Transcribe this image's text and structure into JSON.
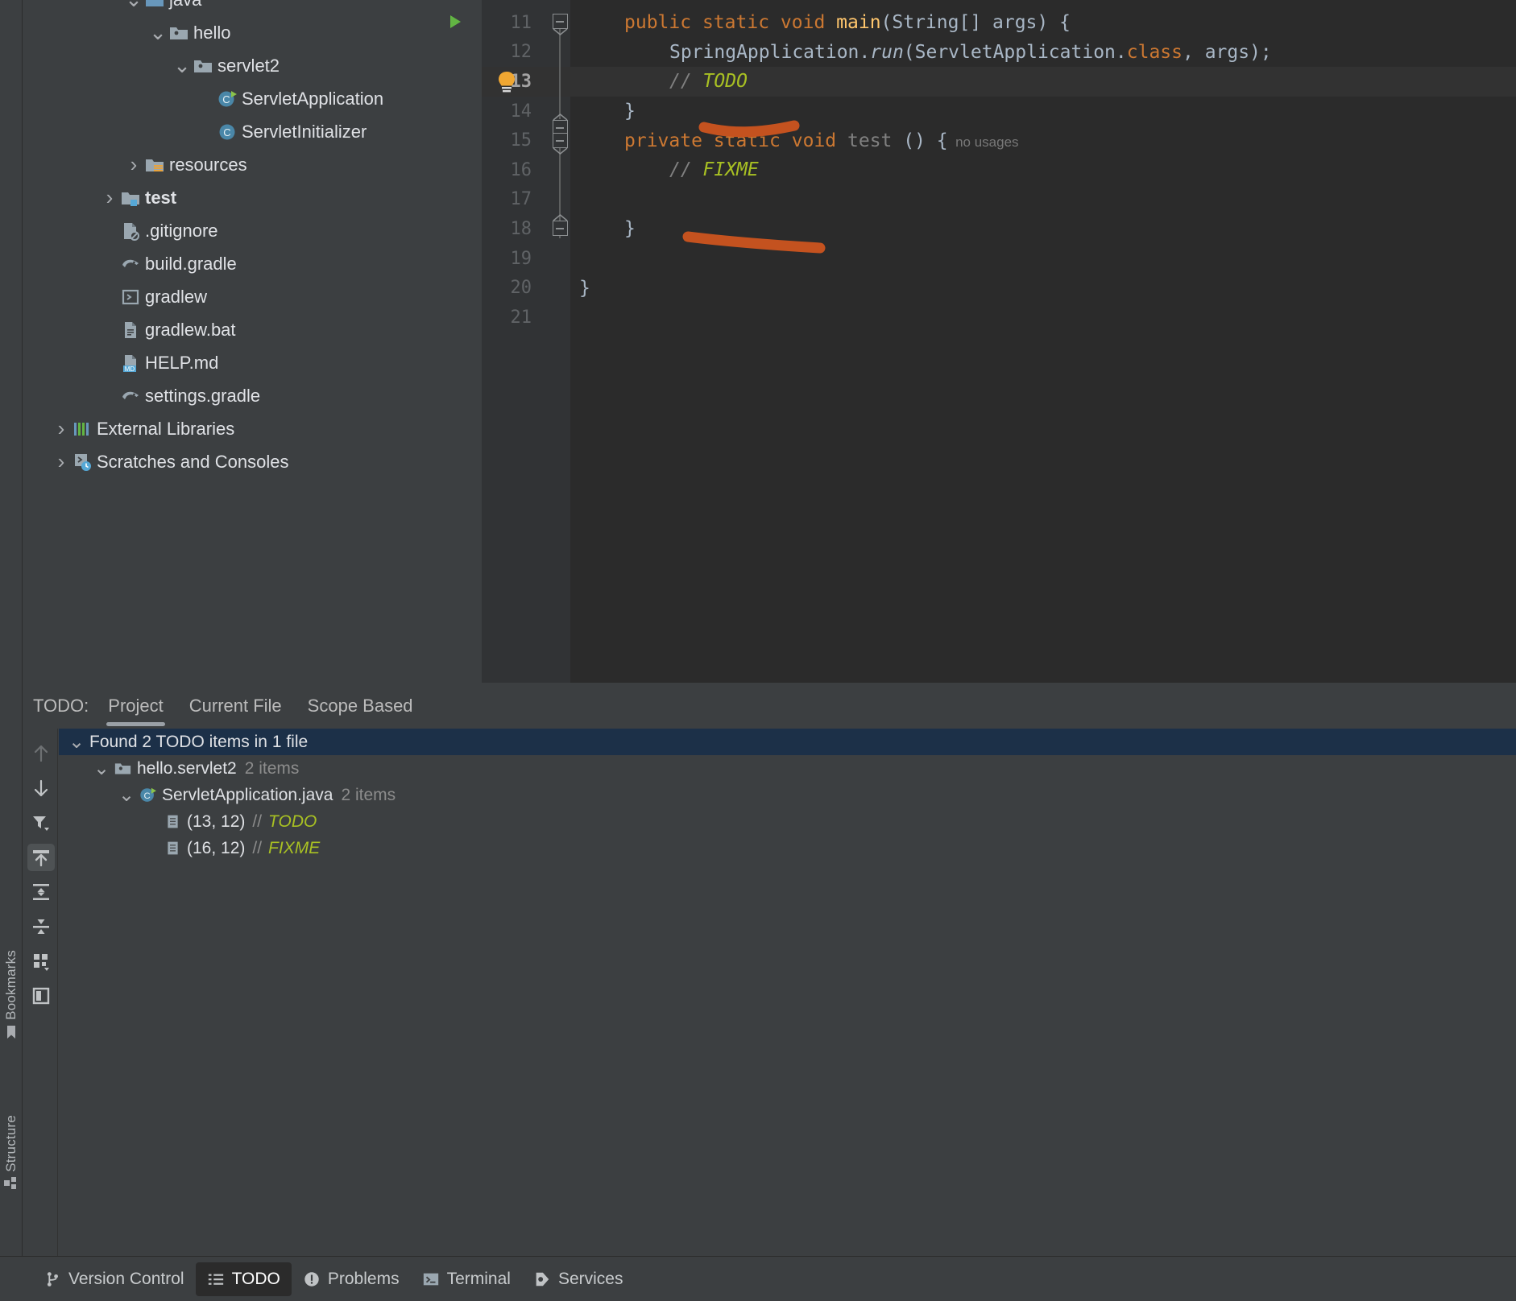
{
  "tool_stripes": {
    "left": [
      {
        "label": "Bookmarks",
        "icon": "bookmark-icon"
      },
      {
        "label": "Structure",
        "icon": "structure-icon"
      }
    ]
  },
  "project_tree": {
    "items": [
      {
        "label": "java",
        "indent": 4,
        "arrow": "down",
        "icon": "source-folder-icon",
        "bold": false,
        "clipped": true
      },
      {
        "label": "hello",
        "indent": 5,
        "arrow": "down",
        "icon": "package-icon",
        "bold": false
      },
      {
        "label": "servlet2",
        "indent": 6,
        "arrow": "down",
        "icon": "package-icon",
        "bold": false
      },
      {
        "label": "ServletApplication",
        "indent": 7,
        "arrow": "none",
        "icon": "java-class-run-icon",
        "bold": false
      },
      {
        "label": "ServletInitializer",
        "indent": 7,
        "arrow": "none",
        "icon": "java-class-icon",
        "bold": false
      },
      {
        "label": "resources",
        "indent": 4,
        "arrow": "right",
        "icon": "resources-folder-icon",
        "bold": false
      },
      {
        "label": "test",
        "indent": 3,
        "arrow": "right",
        "icon": "test-folder-icon",
        "bold": true
      },
      {
        "label": ".gitignore",
        "indent": 3,
        "arrow": "none",
        "icon": "gitignore-icon",
        "bold": false
      },
      {
        "label": "build.gradle",
        "indent": 3,
        "arrow": "none",
        "icon": "gradle-icon",
        "bold": false
      },
      {
        "label": "gradlew",
        "indent": 3,
        "arrow": "none",
        "icon": "shell-script-icon",
        "bold": false
      },
      {
        "label": "gradlew.bat",
        "indent": 3,
        "arrow": "none",
        "icon": "bat-file-icon",
        "bold": false
      },
      {
        "label": "HELP.md",
        "indent": 3,
        "arrow": "none",
        "icon": "markdown-icon",
        "bold": false
      },
      {
        "label": "settings.gradle",
        "indent": 3,
        "arrow": "none",
        "icon": "gradle-icon",
        "bold": false
      },
      {
        "label": "External Libraries",
        "indent": 1,
        "arrow": "right",
        "icon": "libraries-icon",
        "bold": false
      },
      {
        "label": "Scratches and Consoles",
        "indent": 1,
        "arrow": "right",
        "icon": "scratches-icon",
        "bold": false
      }
    ]
  },
  "editor": {
    "first_line_number": 11,
    "current_line": 13,
    "lines": [
      {
        "num": 11,
        "indent": 2,
        "tokens": [
          {
            "t": "public",
            "c": "kw"
          },
          {
            "t": " ",
            "c": "pln"
          },
          {
            "t": "static",
            "c": "kw"
          },
          {
            "t": " ",
            "c": "pln"
          },
          {
            "t": "void",
            "c": "kw"
          },
          {
            "t": " ",
            "c": "pln"
          },
          {
            "t": "main",
            "c": "mth"
          },
          {
            "t": "(String[] args) {",
            "c": "pln"
          }
        ]
      },
      {
        "num": 12,
        "indent": 4,
        "tokens": [
          {
            "t": "SpringApplication.",
            "c": "pln"
          },
          {
            "t": "run",
            "c": "pln ital"
          },
          {
            "t": "(ServletApplication.",
            "c": "pln"
          },
          {
            "t": "class",
            "c": "kw"
          },
          {
            "t": ", args);",
            "c": "pln"
          }
        ]
      },
      {
        "num": 13,
        "indent": 4,
        "tokens": [
          {
            "t": "// ",
            "c": "cmt"
          },
          {
            "t": "TODO",
            "c": "todo"
          }
        ]
      },
      {
        "num": 14,
        "indent": 2,
        "tokens": [
          {
            "t": "}",
            "c": "pln"
          }
        ]
      },
      {
        "num": 15,
        "indent": 2,
        "tokens": [
          {
            "t": "private",
            "c": "kw"
          },
          {
            "t": " ",
            "c": "pln"
          },
          {
            "t": "static",
            "c": "kw"
          },
          {
            "t": " ",
            "c": "pln"
          },
          {
            "t": "void",
            "c": "kw"
          },
          {
            "t": " ",
            "c": "pln"
          },
          {
            "t": "test",
            "c": "grey"
          },
          {
            "t": " () {",
            "c": "pln"
          },
          {
            "t": "  no usages",
            "c": "usg"
          }
        ]
      },
      {
        "num": 16,
        "indent": 4,
        "tokens": [
          {
            "t": "// ",
            "c": "cmt"
          },
          {
            "t": "FIXME",
            "c": "todo"
          }
        ]
      },
      {
        "num": 17,
        "indent": 0,
        "tokens": []
      },
      {
        "num": 18,
        "indent": 2,
        "tokens": [
          {
            "t": "}",
            "c": "pln"
          }
        ]
      },
      {
        "num": 19,
        "indent": 0,
        "tokens": []
      },
      {
        "num": 20,
        "indent": 0,
        "tokens": [
          {
            "t": "}",
            "c": "pln"
          }
        ]
      },
      {
        "num": 21,
        "indent": 0,
        "tokens": []
      }
    ],
    "gutter_icons": [
      {
        "name": "run-gutter-icon",
        "line": 11
      },
      {
        "name": "intention-bulb-icon",
        "line": 13
      }
    ]
  },
  "annotations": {
    "color": "#c4521f",
    "strokes": [
      {
        "name": "underline-todo-annotation"
      },
      {
        "name": "underline-fixme-annotation"
      },
      {
        "name": "circle-todo-tab-annotation"
      }
    ]
  },
  "todo_window": {
    "title": "TODO:",
    "tabs": [
      {
        "label": "Project",
        "active": true
      },
      {
        "label": "Current File",
        "active": false
      },
      {
        "label": "Scope Based",
        "active": false
      }
    ],
    "sidebar_buttons": [
      {
        "name": "previous-occurrence-button",
        "icon": "arrow-up-icon",
        "selected": false,
        "disabled": true
      },
      {
        "name": "next-occurrence-button",
        "icon": "arrow-down-icon",
        "selected": false,
        "disabled": false
      },
      {
        "name": "filter-button",
        "icon": "filter-icon",
        "selected": false,
        "disabled": false
      },
      {
        "name": "autoscroll-to-source-button",
        "icon": "autoscroll-source-icon",
        "selected": true,
        "disabled": false
      },
      {
        "name": "expand-all-button",
        "icon": "expand-all-icon",
        "selected": false,
        "disabled": false
      },
      {
        "name": "collapse-all-button",
        "icon": "collapse-all-icon",
        "selected": false,
        "disabled": false
      },
      {
        "name": "group-by-button",
        "icon": "group-by-icon",
        "selected": false,
        "disabled": false
      },
      {
        "name": "preview-source-button",
        "icon": "preview-panel-icon",
        "selected": false,
        "disabled": false
      }
    ],
    "tree": [
      {
        "depth": 0,
        "arrow": "down",
        "icon": "none",
        "label": "Found 2 TODO items in 1 file",
        "suffix": "",
        "selected": true,
        "comment": ""
      },
      {
        "depth": 1,
        "arrow": "down",
        "icon": "package-icon",
        "label": "hello.servlet2",
        "suffix": "2 items",
        "selected": false,
        "comment": ""
      },
      {
        "depth": 2,
        "arrow": "down",
        "icon": "java-class-run-icon",
        "label": "ServletApplication.java",
        "suffix": "2 items",
        "selected": false,
        "comment": ""
      },
      {
        "depth": 3,
        "arrow": "none",
        "icon": "todo-item-icon",
        "label": "(13, 12)",
        "suffix": "",
        "selected": false,
        "comment": "TODO"
      },
      {
        "depth": 3,
        "arrow": "none",
        "icon": "todo-item-icon",
        "label": "(16, 12)",
        "suffix": "",
        "selected": false,
        "comment": "FIXME"
      }
    ]
  },
  "status_bar": {
    "items": [
      {
        "label": "Version Control",
        "icon": "branch-icon",
        "active": false
      },
      {
        "label": "TODO",
        "icon": "todo-list-icon",
        "active": true
      },
      {
        "label": "Problems",
        "icon": "problems-icon",
        "active": false
      },
      {
        "label": "Terminal",
        "icon": "terminal-icon",
        "active": false
      },
      {
        "label": "Services",
        "icon": "services-icon",
        "active": false
      }
    ]
  },
  "colors": {
    "panel_bg": "#3c3f41",
    "editor_bg": "#2b2b2b",
    "gutter_bg": "#313335",
    "selection_bg": "#1c3048",
    "todo_green": "#a8c023",
    "keyword_orange": "#cc7832",
    "annotation_orange": "#c4521f"
  }
}
